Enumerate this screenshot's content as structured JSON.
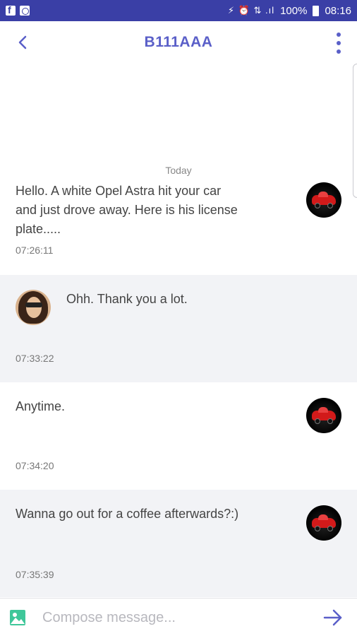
{
  "status_bar": {
    "signal_glyphs": "⚡ ⏰ ⇅ .ıl",
    "battery": "100%",
    "time": "08:16"
  },
  "app_bar": {
    "title": "B111AAA"
  },
  "date_separator": "Today",
  "messages": [
    {
      "text_lines": [
        "Hello. A white Opel Astra hit your car",
        "and just drove away. Here is his license",
        "plate....."
      ],
      "time": "07:26:11",
      "sender": "car"
    },
    {
      "text": "Ohh. Thank you a lot.",
      "time": "07:33:22",
      "sender": "person"
    },
    {
      "text": "Anytime.",
      "time": "07:34:20",
      "sender": "car"
    },
    {
      "text": "Wanna go out for a coffee afterwards?:)",
      "time": "07:35:39",
      "sender": "car"
    }
  ],
  "compose": {
    "placeholder": "Compose message...",
    "value": ""
  },
  "colors": {
    "status_bar": "#3a3fa6",
    "accent": "#5a5fc8",
    "gray_row": "#f2f3f6",
    "image_icon": "#3fc79a"
  }
}
